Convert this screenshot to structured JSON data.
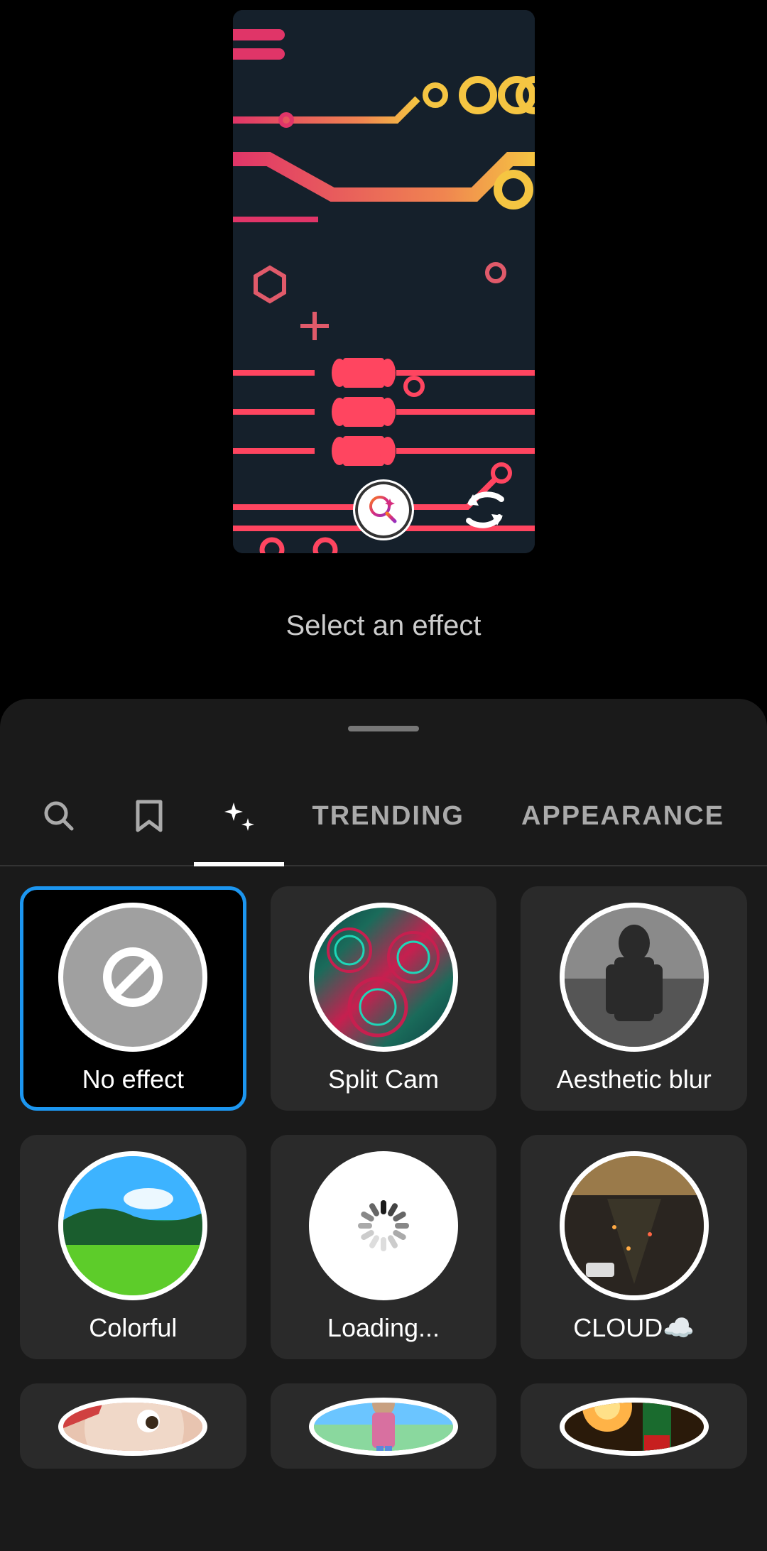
{
  "preview": {
    "select_text": "Select an effect"
  },
  "tabs": {
    "trending": "TRENDING",
    "appearance": "APPEARANCE"
  },
  "effects": [
    {
      "label": "No effect",
      "selected": true
    },
    {
      "label": "Split Cam"
    },
    {
      "label": "Aesthetic blur"
    },
    {
      "label": "Colorful"
    },
    {
      "label": "Loading..."
    },
    {
      "label": "CLOUD☁️"
    }
  ]
}
